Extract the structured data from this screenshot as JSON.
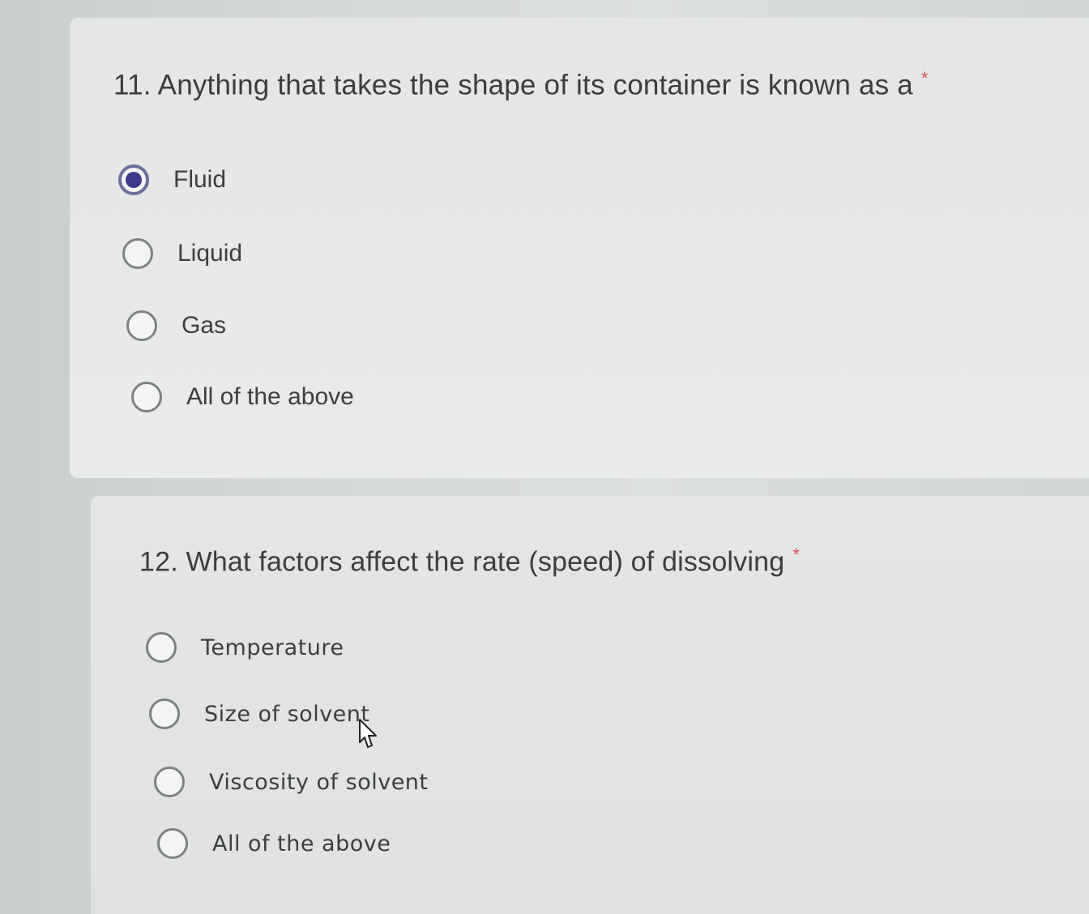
{
  "form": {
    "required_marker": "*",
    "questions": [
      {
        "text": "11. Anything that takes the shape of its container is known as a",
        "selected": "Fluid",
        "options": [
          {
            "label": "Fluid",
            "checked": true
          },
          {
            "label": "Liquid",
            "checked": false
          },
          {
            "label": "Gas",
            "checked": false
          },
          {
            "label": "All of the above",
            "checked": false
          }
        ]
      },
      {
        "text": "12. What factors affect the rate (speed) of dissolving",
        "selected": "",
        "options": [
          {
            "label": "Temperature",
            "checked": false
          },
          {
            "label": "Size of solvent",
            "checked": false
          },
          {
            "label": "Viscosity of solvent",
            "checked": false
          },
          {
            "label": "All of the above",
            "checked": false
          }
        ]
      }
    ]
  },
  "colors": {
    "required_asterisk": "#d6525a",
    "radio_selected": "#3e3a8a",
    "question_text": "#3b3d3e"
  },
  "icons": {
    "cursor": "hand-pointer-icon",
    "radio": "radio-button-icon"
  }
}
